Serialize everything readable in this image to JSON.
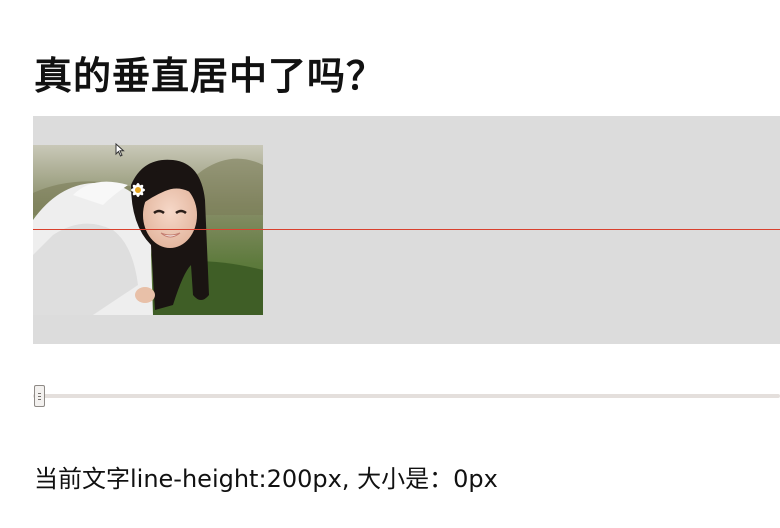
{
  "page": {
    "title": "真的垂直居中了吗？"
  },
  "demo": {
    "image_description": "photo-girl-in-white-jacket",
    "guide_line_color": "#d9412e",
    "box_color": "#dcdcdc"
  },
  "slider": {
    "value_fraction": 0
  },
  "status": {
    "prefix": "当前文字line-height:",
    "line_height": "200px",
    "separator": ", 大小是：",
    "font_size": "0px"
  }
}
